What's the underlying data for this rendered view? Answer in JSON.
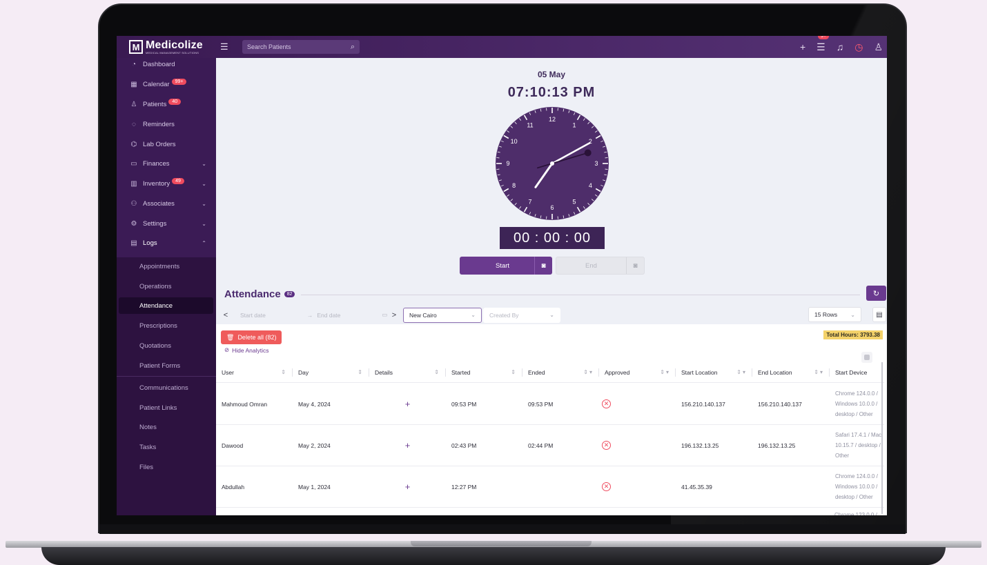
{
  "brand": {
    "name": "Medicolize",
    "sub": "MEDICAL MANAGEMENT SOLUTIONS",
    "logo_letter": "M"
  },
  "topbar": {
    "search_placeholder": "Search Patients",
    "notif_badge": "9+"
  },
  "sidebar": {
    "items": [
      {
        "label": "Dashboard",
        "icon": "dashboard-icon",
        "glyph": "◔"
      },
      {
        "label": "Calendar",
        "icon": "calendar-icon",
        "glyph": "▦",
        "badge": "99+"
      },
      {
        "label": "Patients",
        "icon": "user-icon",
        "glyph": "♙",
        "badge": "40"
      },
      {
        "label": "Reminders",
        "icon": "alarm-icon",
        "glyph": "◌"
      },
      {
        "label": "Lab Orders",
        "icon": "flask-icon",
        "glyph": "⌬"
      },
      {
        "label": "Finances",
        "icon": "finance-icon",
        "glyph": "▭"
      },
      {
        "label": "Inventory",
        "icon": "inventory-icon",
        "glyph": "▥",
        "badge": "49"
      },
      {
        "label": "Associates",
        "icon": "associates-icon",
        "glyph": "⚇"
      },
      {
        "label": "Settings",
        "icon": "settings-icon",
        "glyph": "⚙"
      },
      {
        "label": "Logs",
        "icon": "logs-icon",
        "glyph": "▤"
      }
    ],
    "sub_items": [
      "Appointments",
      "Operations",
      "Attendance",
      "Prescriptions",
      "Quotations",
      "Patient Forms",
      "Communications",
      "Patient Links",
      "Notes",
      "Tasks",
      "Files"
    ]
  },
  "clock": {
    "date": "05 May",
    "time": "07:10:13 PM",
    "numbers": [
      "12",
      "1",
      "2",
      "3",
      "4",
      "5",
      "6",
      "7",
      "8",
      "9",
      "10",
      "11"
    ],
    "hour": 7,
    "minute": 10,
    "second": 13,
    "face_color": "#4e2d6a"
  },
  "timer": {
    "value": "00 : 00 : 00"
  },
  "actions": {
    "start_label": "Start",
    "end_label": "End"
  },
  "attendance": {
    "title": "Attendance",
    "count": "82",
    "filters": {
      "start_placeholder": "Start date",
      "end_placeholder": "End date",
      "date_sep": "→",
      "branch": "New Cairo",
      "created_by_placeholder": "Created By",
      "rows": "15 Rows"
    },
    "delete_label": "Delete all (82)",
    "hide_label": "Hide Analytics",
    "total_hours": "Total Hours: 3793.38",
    "columns": [
      "User",
      "Day",
      "Details",
      "Started",
      "Ended",
      "Approved",
      "Start Location",
      "End Location",
      "Start Device"
    ],
    "rows": [
      {
        "user": "Mahmoud Omran",
        "day": "May 4, 2024",
        "details": "+",
        "started": "09:53 PM",
        "ended": "09:53 PM",
        "approved": "✕",
        "start_loc": "156.210.140.137",
        "end_loc": "156.210.140.137",
        "device": "Chrome 124.0.0 / Windows 10.0.0 / desktop / Other"
      },
      {
        "user": "Dawood",
        "day": "May 2, 2024",
        "details": "+",
        "started": "02:43 PM",
        "ended": "02:44 PM",
        "approved": "✕",
        "start_loc": "196.132.13.25",
        "end_loc": "196.132.13.25",
        "device": "Safari 17.4.1 / Mac 10.15.7 / desktop / Other"
      },
      {
        "user": "Abdullah",
        "day": "May 1, 2024",
        "details": "+",
        "started": "12:27 PM",
        "ended": "",
        "approved": "✕",
        "start_loc": "41.45.35.39",
        "end_loc": "",
        "device": "Chrome 124.0.0 / Windows 10.0.0 / desktop / Other"
      },
      {
        "user": "",
        "day": "",
        "details": "",
        "started": "",
        "ended": "",
        "approved": "",
        "start_loc": "",
        "end_loc": "",
        "device": "Chrome 123.0.0 /"
      }
    ]
  },
  "colors": {
    "accent": "#6a3a8f",
    "sidebar": "#3b1b55",
    "danger": "#ef5b5b",
    "highlight": "#f4d26a"
  }
}
